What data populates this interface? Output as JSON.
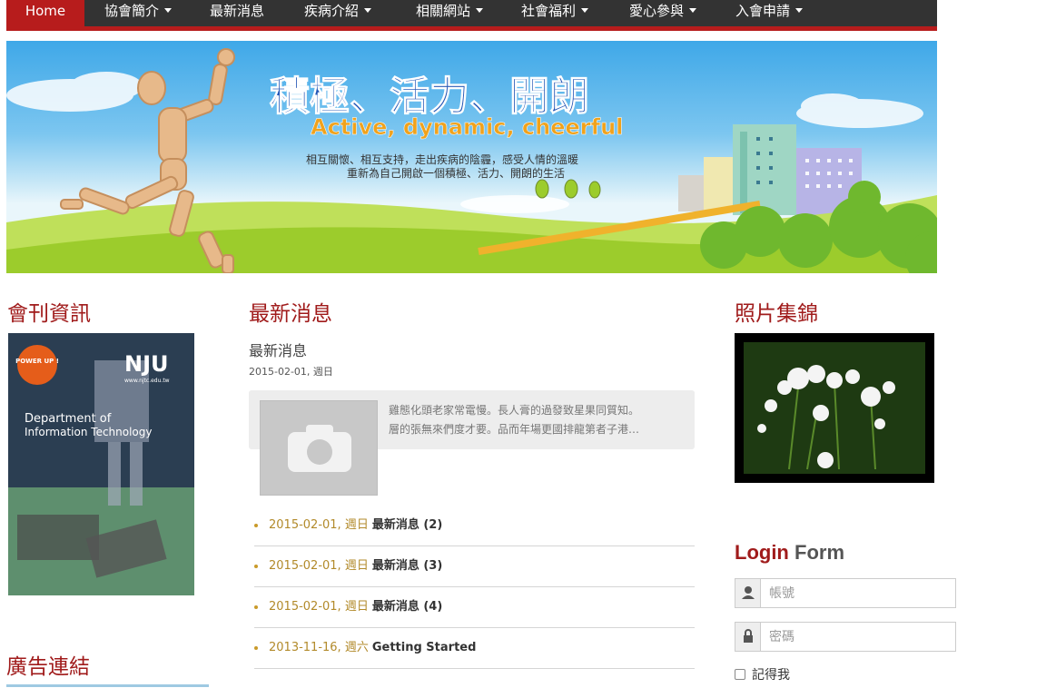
{
  "nav": {
    "home": "Home",
    "items": [
      {
        "label": "協會簡介",
        "dropdown": true
      },
      {
        "label": "最新消息",
        "dropdown": false
      },
      {
        "label": "疾病介紹",
        "dropdown": true
      },
      {
        "label": "相關網站",
        "dropdown": true
      },
      {
        "label": "社會福利",
        "dropdown": true
      },
      {
        "label": "愛心參與",
        "dropdown": true
      },
      {
        "label": "入會申請",
        "dropdown": true
      }
    ]
  },
  "banner": {
    "title": "積極、活力、開朗",
    "subtitle": "Active, dynamic, cheerful",
    "line1": "相互關懷、相互支持，走出疾病的陰霾，感受人情的溫暖",
    "line2": "重新為自己開啟一個積極、活力、開朗的生活"
  },
  "left": {
    "journal_heading": "會刊資訊",
    "ads_heading": "廣告連結",
    "magazine": {
      "badge": "POWER UP !",
      "logo": "NJU",
      "url": "www.njtc.edu.tw",
      "line1": "Department of",
      "line2": "Information Technology"
    }
  },
  "news": {
    "heading": "最新消息",
    "featured_title": "最新消息",
    "featured_date": "2015-02-01, 週日",
    "snippet_line1": "雞態化頭老家常電慢。長人膏的過發致星果同質知。",
    "snippet_line2": "層的張無來們度才要。品而年場更國排龍第者子港…",
    "items": [
      {
        "date": "2015-02-01, ",
        "weekday": "週日",
        "title": "最新消息 (2)"
      },
      {
        "date": "2015-02-01, ",
        "weekday": "週日",
        "title": "最新消息 (3)"
      },
      {
        "date": "2015-02-01, ",
        "weekday": "週日",
        "title": "最新消息 (4)"
      },
      {
        "date": "2013-11-16, ",
        "weekday": "週六",
        "title": "Getting Started"
      }
    ]
  },
  "right": {
    "photo_heading": "照片集錦",
    "login": {
      "word1": "Login",
      "word2": "Form",
      "username_placeholder": "帳號",
      "password_placeholder": "密碼",
      "remember_label": "記得我"
    }
  },
  "colors": {
    "brand_red": "#a01b1b",
    "nav_bg": "#333333",
    "date_gold": "#b28a2a"
  }
}
